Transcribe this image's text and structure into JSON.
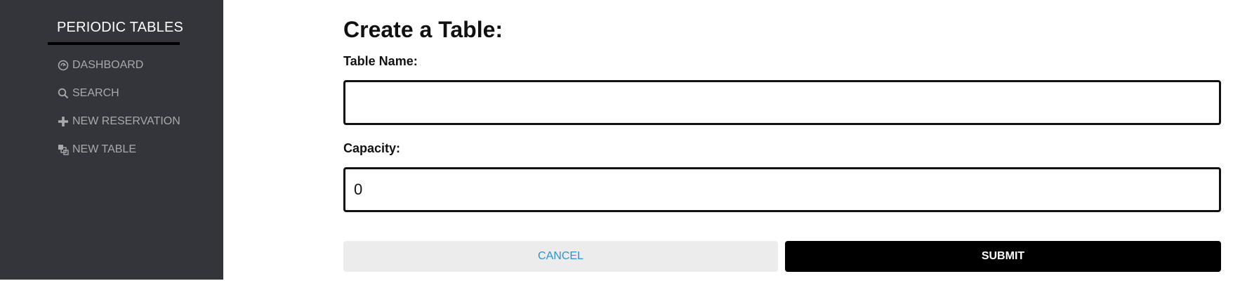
{
  "app": {
    "brand": "PERIODIC TABLES"
  },
  "sidebar": {
    "items": [
      {
        "label": "DASHBOARD",
        "icon": "dashboard-icon"
      },
      {
        "label": "SEARCH",
        "icon": "search-icon"
      },
      {
        "label": "NEW RESERVATION",
        "icon": "plus-icon"
      },
      {
        "label": "NEW TABLE",
        "icon": "tables-icon"
      }
    ]
  },
  "form": {
    "title": "Create a Table:",
    "table_name": {
      "label": "Table Name:",
      "value": ""
    },
    "capacity": {
      "label": "Capacity:",
      "value": "0"
    },
    "cancel_label": "CANCEL",
    "submit_label": "SUBMIT"
  },
  "colors": {
    "sidebar_bg": "#33353b",
    "sidebar_text": "#a7a9ad",
    "cancel_text": "#2a93d5",
    "submit_bg": "#000000"
  }
}
